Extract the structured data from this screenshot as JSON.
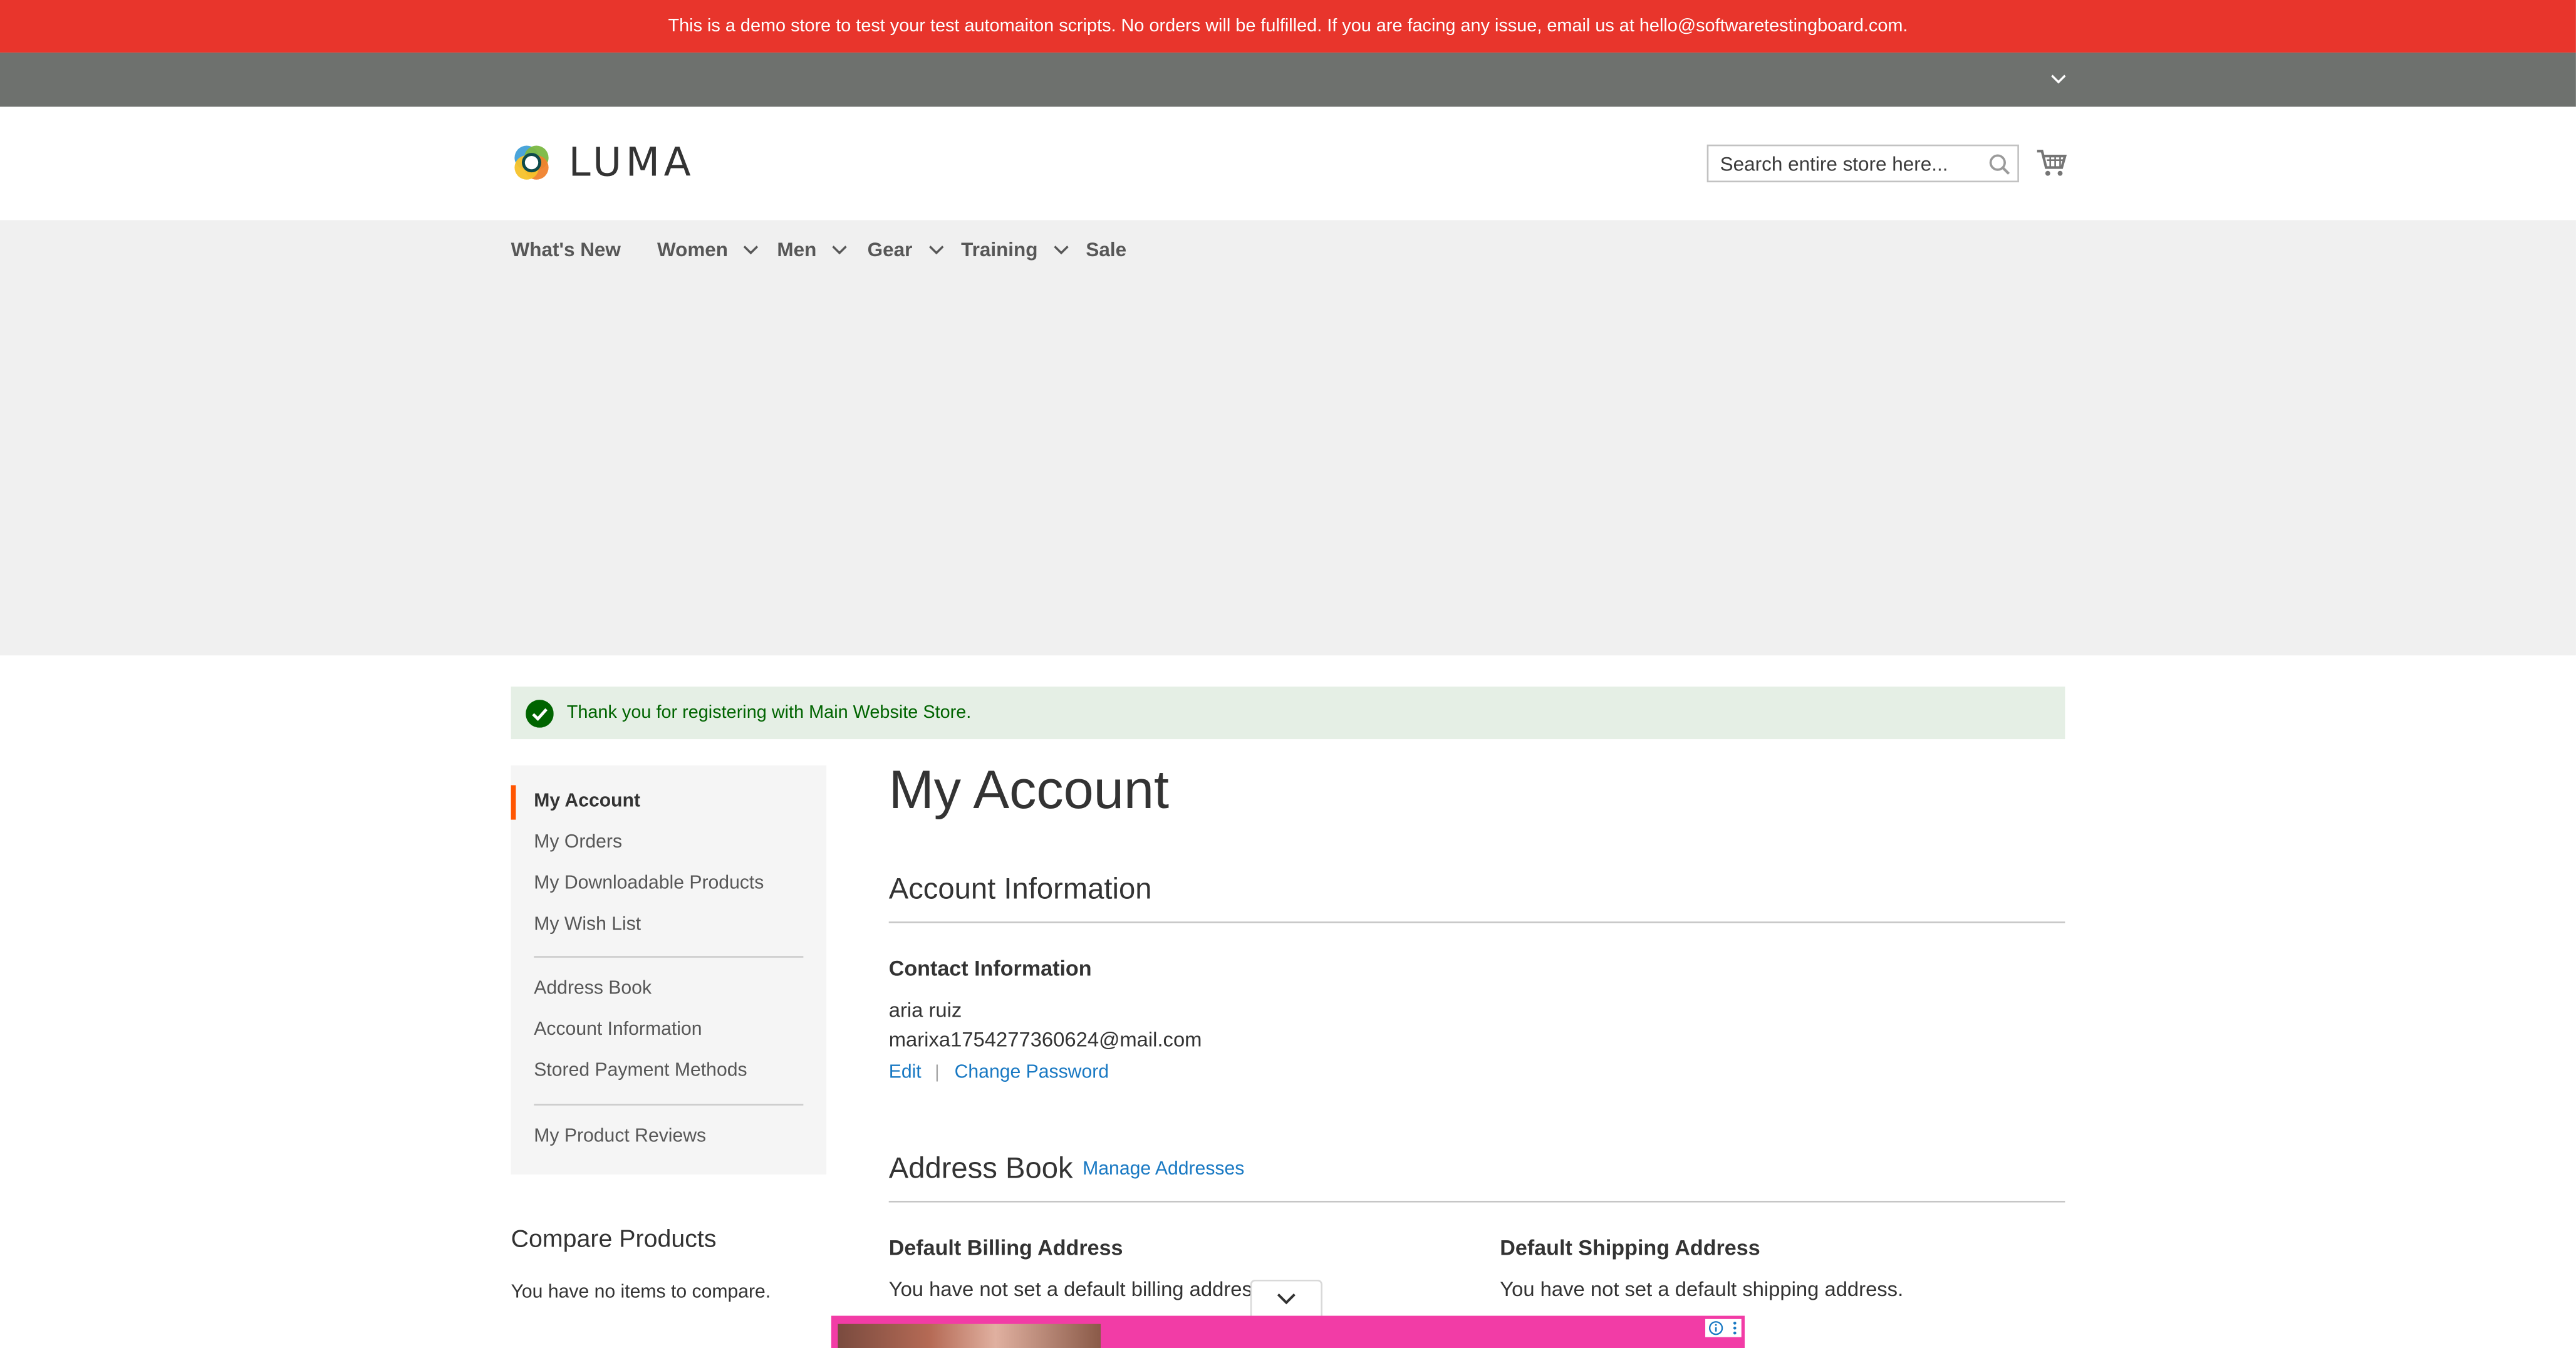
{
  "demo_notice": "This is a demo store to test your test automaiton scripts. No orders will be fulfilled. If you are facing any issue, email us at hello@softwaretestingboard.com.",
  "header": {
    "logo_text": "LUMA",
    "search_placeholder": "Search entire store here...",
    "search_value": ""
  },
  "nav": {
    "items": [
      {
        "label": "What's New",
        "has_dropdown": false
      },
      {
        "label": "Women",
        "has_dropdown": true
      },
      {
        "label": "Men",
        "has_dropdown": true
      },
      {
        "label": "Gear",
        "has_dropdown": true
      },
      {
        "label": "Training",
        "has_dropdown": true
      },
      {
        "label": "Sale",
        "has_dropdown": false
      }
    ]
  },
  "message": {
    "type": "success",
    "text": "Thank you for registering with Main Website Store."
  },
  "sidebar": {
    "groups": [
      [
        "My Account",
        "My Orders",
        "My Downloadable Products",
        "My Wish List"
      ],
      [
        "Address Book",
        "Account Information",
        "Stored Payment Methods"
      ],
      [
        "My Product Reviews"
      ]
    ],
    "active": "My Account"
  },
  "compare": {
    "title": "Compare Products",
    "empty_text": "You have no items to compare."
  },
  "main": {
    "page_title": "My Account",
    "account_info": {
      "title": "Account Information",
      "contact_title": "Contact Information",
      "name": "aria ruiz",
      "email": "marixa1754277360624@mail.com",
      "edit_label": "Edit",
      "separator": "|",
      "change_password_label": "Change Password"
    },
    "address_book": {
      "title": "Address Book",
      "manage_label": "Manage Addresses",
      "billing_title": "Default Billing Address",
      "billing_text": "You have not set a default billing address.",
      "shipping_title": "Default Shipping Address",
      "shipping_text": "You have not set a default shipping address."
    }
  },
  "colors": {
    "demo_bar": "#e8352c",
    "panel_bar": "#6e716e",
    "nav_bg": "#f0f0f0",
    "link": "#1979c3",
    "success_bg": "#e5efe5",
    "success_text": "#006400",
    "active_marker": "#ff5501",
    "ad_bg": "#f23ca6"
  },
  "icons": [
    "chevron-down-icon",
    "search-icon",
    "cart-icon",
    "check-circle-icon",
    "info-icon",
    "more-vertical-icon"
  ]
}
